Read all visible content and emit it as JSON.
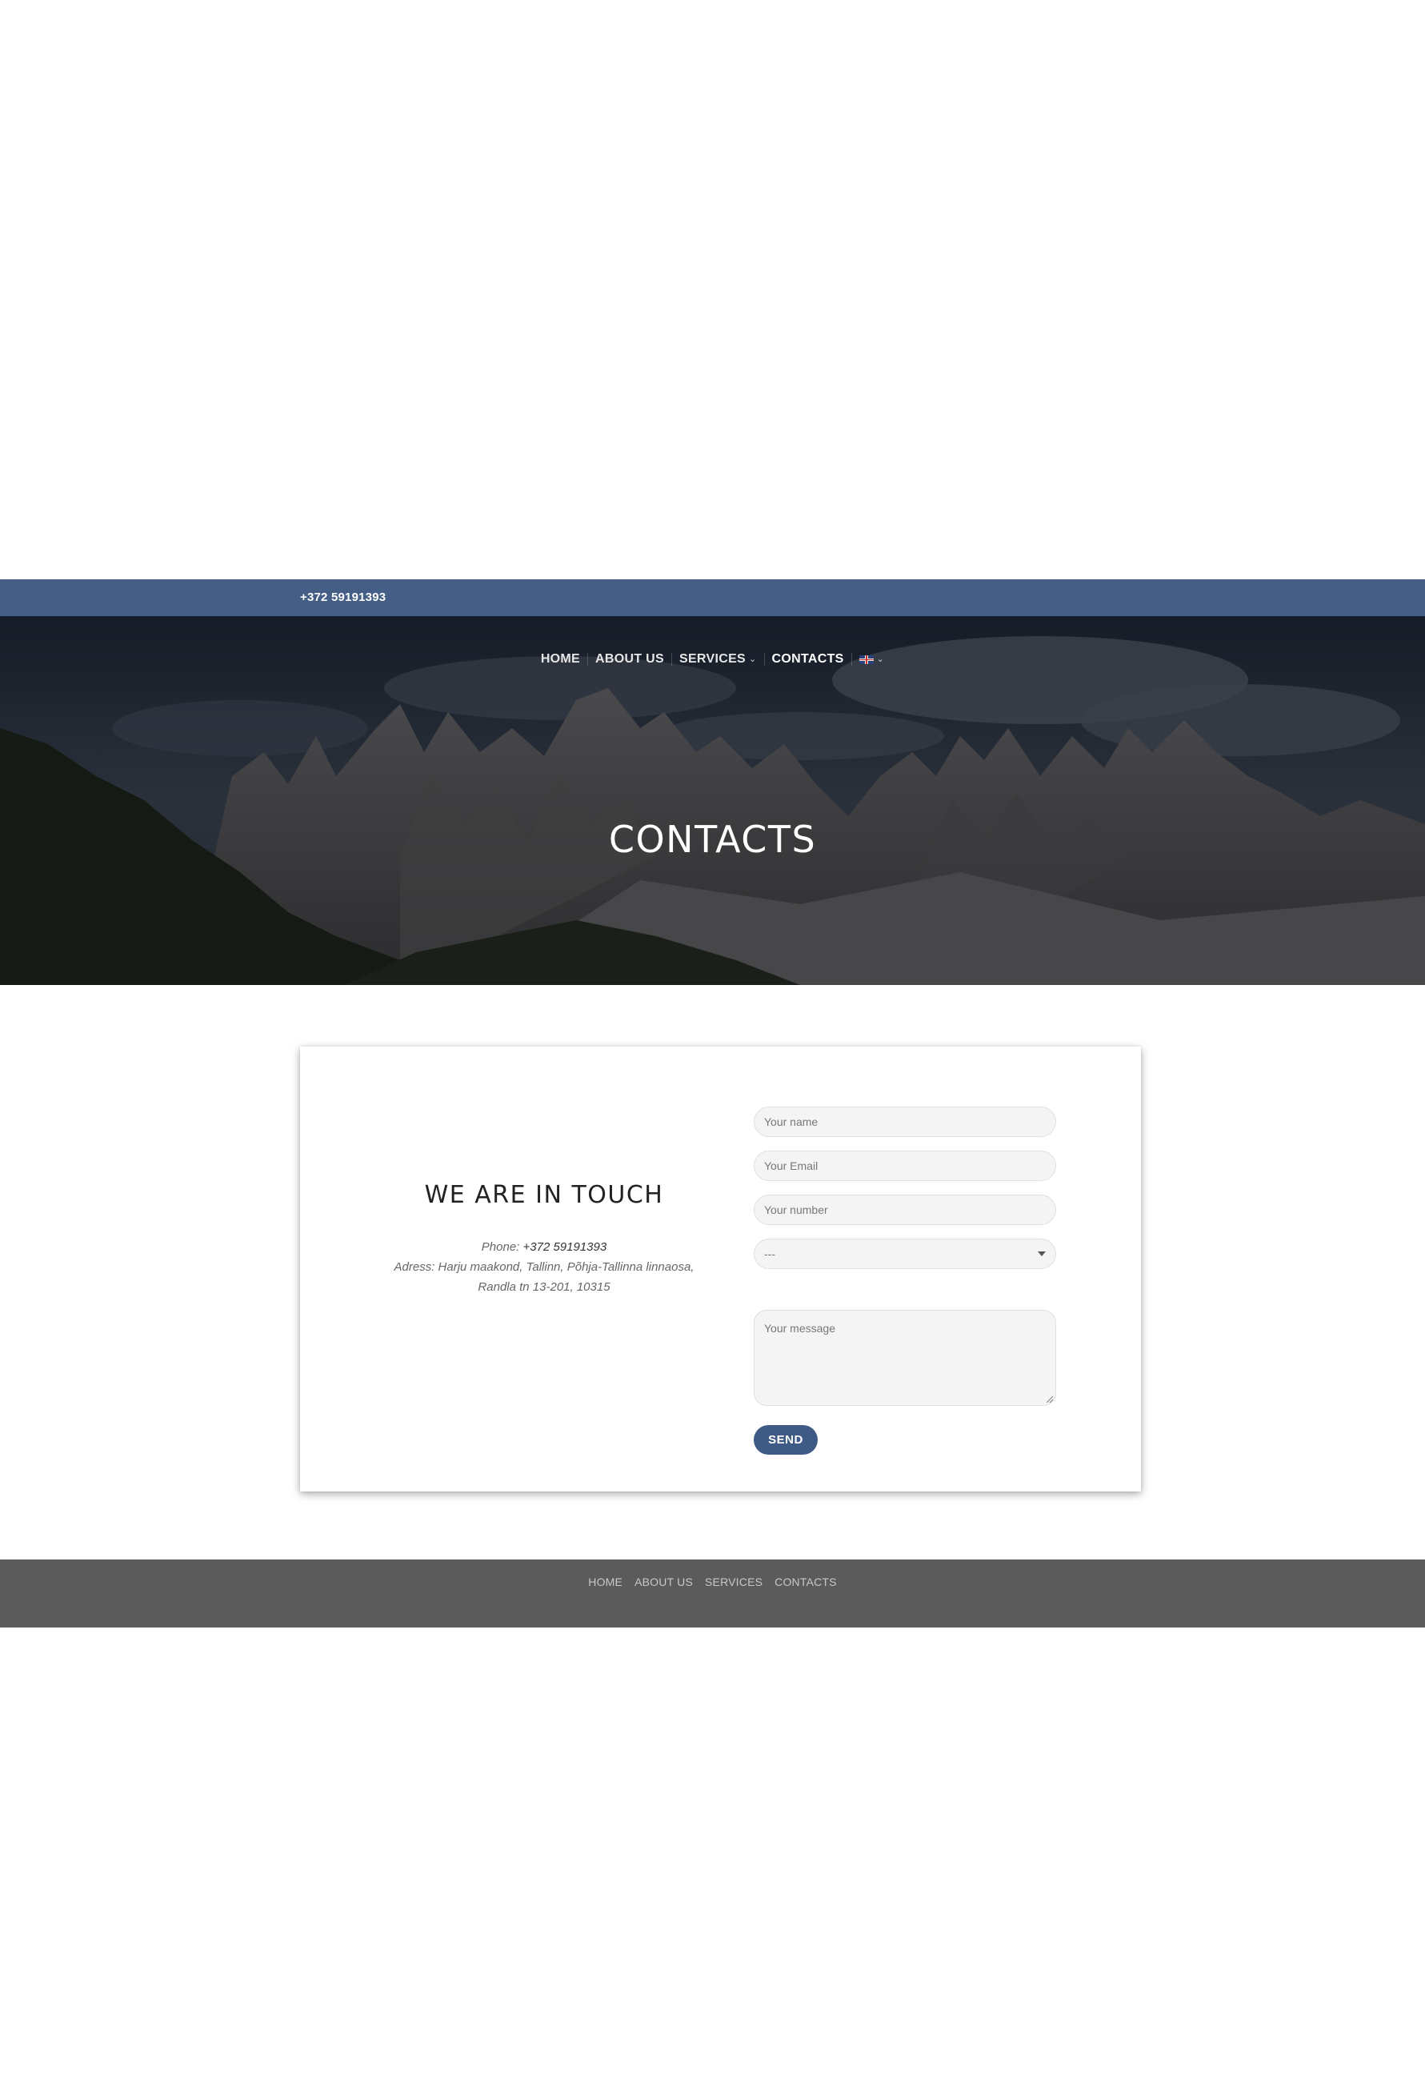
{
  "top_bar": {
    "phone": "+372 59191393"
  },
  "nav": {
    "items": [
      {
        "label": "HOME"
      },
      {
        "label": "ABOUT US"
      },
      {
        "label": "SERVICES"
      },
      {
        "label": "CONTACTS"
      }
    ],
    "language_icon": "uk-flag-icon"
  },
  "hero": {
    "title": "CONTACTS"
  },
  "contact": {
    "title": "WE ARE IN TOUCH",
    "phone_label": "Phone: ",
    "phone_value": "+372 59191393",
    "address_line1": "Adress: Harju maakond, Tallinn, Põhja-Tallinna linnaosa,",
    "address_line2": "Randla tn 13-201, 10315"
  },
  "form": {
    "name_placeholder": "Your name",
    "email_placeholder": "Your Email",
    "number_placeholder": "Your number",
    "select_value": "---",
    "message_placeholder": "Your message",
    "send_label": "SEND"
  },
  "footer": {
    "links": [
      {
        "label": "HOME"
      },
      {
        "label": "ABOUT US"
      },
      {
        "label": "SERVICES"
      },
      {
        "label": "CONTACTS"
      }
    ]
  },
  "colors": {
    "top_bar": "#445e86",
    "button": "#3f5a84",
    "footer": "#5b5b5b"
  }
}
